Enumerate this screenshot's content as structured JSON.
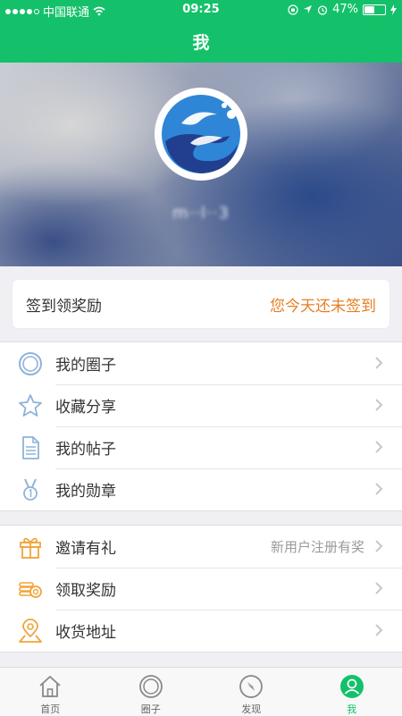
{
  "status_bar": {
    "carrier": "中国联通",
    "time": "09:25",
    "battery_percent": "47%",
    "battery_level": 0.47,
    "icons": [
      "wifi-icon",
      "orientation-lock-icon",
      "location-icon",
      "alarm-icon",
      "battery-icon",
      "charging-icon"
    ]
  },
  "nav": {
    "title": "我"
  },
  "profile": {
    "username": "m··l··3",
    "avatar_icon": "app-logo-icon"
  },
  "checkin": {
    "label": "签到领奖励",
    "status": "您今天还未签到"
  },
  "menu_groups": [
    {
      "items": [
        {
          "label": "我的圈子",
          "icon": "circle-icon"
        },
        {
          "label": "收藏分享",
          "icon": "star-icon"
        },
        {
          "label": "我的帖子",
          "icon": "document-icon"
        },
        {
          "label": "我的勋章",
          "icon": "medal-icon"
        }
      ]
    },
    {
      "items": [
        {
          "label": "邀请有礼",
          "icon": "gift-icon",
          "extra": "新用户注册有奖"
        },
        {
          "label": "领取奖励",
          "icon": "coins-icon"
        },
        {
          "label": "收货地址",
          "icon": "map-pin-icon"
        }
      ]
    }
  ],
  "tabs": [
    {
      "label": "首页",
      "icon": "home-icon"
    },
    {
      "label": "圈子",
      "icon": "circle-icon"
    },
    {
      "label": "发现",
      "icon": "compass-icon"
    },
    {
      "label": "我",
      "icon": "user-icon",
      "active": true
    }
  ],
  "colors": {
    "primary_green": "#14c16a",
    "accent_orange": "#e67e22",
    "icon_blue": "#8fb3d9",
    "icon_orange": "#f0a43a"
  }
}
